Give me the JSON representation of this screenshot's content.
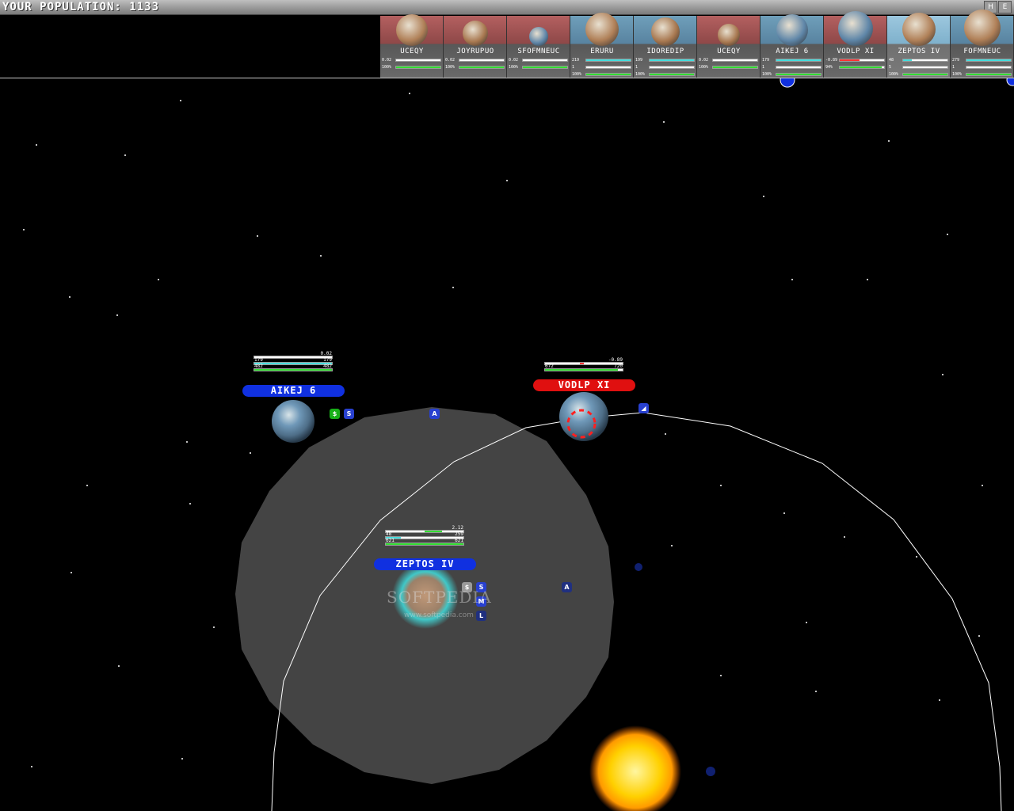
{
  "hud": {
    "population_label": "YOUR POPULATION: 1133",
    "btn_h": "H",
    "btn_e": "E"
  },
  "cards": [
    {
      "name": "UCEQY",
      "type": "enemy",
      "planet_color": "#b08058",
      "size": 40,
      "row1": {
        "label": "0.02",
        "fill": 0.5,
        "color": "#ffffff"
      },
      "row2": {
        "label": "100%",
        "fill": 1.0,
        "color": "#33dd33"
      }
    },
    {
      "name": "JOYRUPUO",
      "type": "enemy",
      "planet_color": "#a87850",
      "size": 32,
      "row1": {
        "label": "0.02",
        "fill": 0.5,
        "color": "#ffffff"
      },
      "row2": {
        "label": "100%",
        "fill": 1.0,
        "color": "#33dd33"
      }
    },
    {
      "name": "SFOFMNEUC",
      "type": "enemy",
      "planet_color": "#5f86a8",
      "size": 24,
      "row1": {
        "label": "0.02",
        "fill": 0.5,
        "color": "#ffffff"
      },
      "row2": {
        "label": "100%",
        "fill": 1.0,
        "color": "#33dd33"
      }
    },
    {
      "name": "ERURU",
      "type": "own",
      "planet_color": "#b08058",
      "size": 42,
      "row1": {
        "label": "219",
        "fill": 1.0,
        "color": "#44dddd"
      },
      "row2": {
        "label": "1",
        "fill": 0.5,
        "color": "#ffffff"
      },
      "row3": {
        "label": "100%",
        "fill": 1.0,
        "color": "#33dd33"
      }
    },
    {
      "name": "IDOREDIP",
      "type": "own",
      "planet_color": "#a87850",
      "size": 36,
      "row1": {
        "label": "199",
        "fill": 1.0,
        "color": "#44dddd"
      },
      "row2": {
        "label": "1",
        "fill": 0.5,
        "color": "#ffffff"
      },
      "row3": {
        "label": "100%",
        "fill": 1.0,
        "color": "#33dd33"
      }
    },
    {
      "name": "UCEQY",
      "type": "enemy",
      "planet_color": "#a87850",
      "size": 28,
      "row1": {
        "label": "0.02",
        "fill": 0.5,
        "color": "#ffffff"
      },
      "row2": {
        "label": "100%",
        "fill": 1.0,
        "color": "#33dd33"
      }
    },
    {
      "name": "AIKEJ 6",
      "type": "own",
      "planet_color": "#5f86a8",
      "size": 40,
      "row1": {
        "label": "179",
        "fill": 1.0,
        "color": "#44dddd"
      },
      "row2": {
        "label": "1",
        "fill": 0.5,
        "color": "#ffffff"
      },
      "row3": {
        "label": "100%",
        "fill": 1.0,
        "color": "#33dd33"
      }
    },
    {
      "name": "VODLP XI",
      "type": "enemy",
      "planet_color": "#5f86a8",
      "size": 44,
      "row1": {
        "label": "-0.89",
        "fill": 0.45,
        "color": "#ff3333"
      },
      "row2": {
        "label": "94%",
        "fill": 0.94,
        "color": "#33dd33"
      }
    },
    {
      "name": "ZEPTOS IV",
      "type": "selected",
      "planet_color": "#b08058",
      "size": 42,
      "row1": {
        "label": "48",
        "fill": 0.2,
        "color": "#44dddd"
      },
      "row2": {
        "label": "5",
        "fill": 0.6,
        "color": "#ffffff"
      },
      "row3": {
        "label": "100%",
        "fill": 1.0,
        "color": "#33dd33"
      }
    },
    {
      "name": "FOFMNEUC",
      "type": "own",
      "planet_color": "#b08058",
      "size": 46,
      "row1": {
        "label": "279",
        "fill": 1.0,
        "color": "#44dddd"
      },
      "row2": {
        "label": "1",
        "fill": 0.5,
        "color": "#ffffff"
      },
      "row3": {
        "label": "100%",
        "fill": 1.0,
        "color": "#33dd33"
      }
    }
  ],
  "planets": {
    "aikej": {
      "name": "AIKEJ 6",
      "growth": "0.02",
      "pop": "179",
      "pop_max": "179",
      "def": "482",
      "def_max": "482"
    },
    "vodlp": {
      "name": "VODLP XI",
      "growth": "-0.89",
      "pop": "672",
      "pop_max": "720"
    },
    "zeptos": {
      "name": "ZEPTOS IV",
      "growth": "2.12",
      "pop": "48",
      "pop_max": "259",
      "def": "621",
      "def_max": "621"
    }
  },
  "ships": {
    "s1": "$",
    "s2": "S",
    "s3": "A",
    "s4": "A",
    "s5": "S",
    "s6": "M",
    "s7": "L",
    "s8": "$"
  },
  "watermark": {
    "main": "SOFTPEDIA",
    "sub": "www.softpedia.com"
  },
  "colors": {
    "own": "#1030e0",
    "enemy": "#e01010",
    "range": "#444444"
  }
}
